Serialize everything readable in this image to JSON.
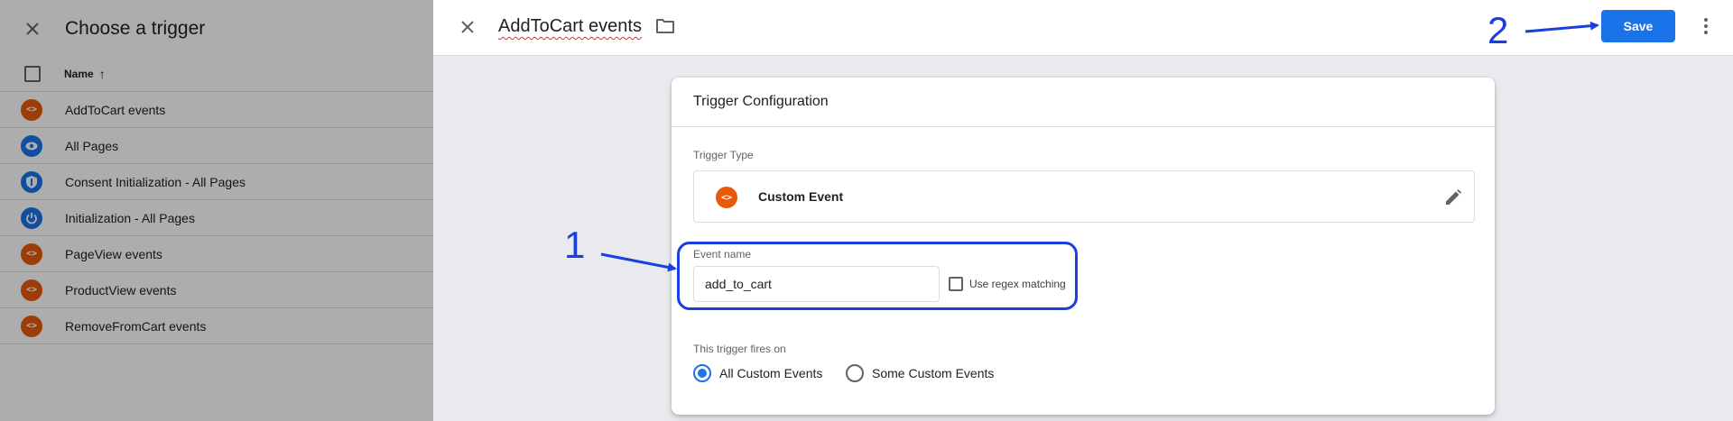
{
  "left_panel": {
    "title": "Choose a trigger",
    "column_header": "Name",
    "sort_arrow": "↑",
    "triggers": [
      {
        "label": "AddToCart events",
        "icon": "code-icon",
        "color": "#e8590c"
      },
      {
        "label": "All Pages",
        "icon": "eye-icon",
        "color": "#1a73e8"
      },
      {
        "label": "Consent Initialization - All Pages",
        "icon": "shield-icon",
        "color": "#1a73e8"
      },
      {
        "label": "Initialization - All Pages",
        "icon": "power-icon",
        "color": "#1a73e8"
      },
      {
        "label": "PageView events",
        "icon": "code-icon",
        "color": "#e8590c"
      },
      {
        "label": "ProductView events",
        "icon": "code-icon",
        "color": "#e8590c"
      },
      {
        "label": "RemoveFromCart events",
        "icon": "code-icon",
        "color": "#e8590c"
      }
    ]
  },
  "header": {
    "title": "AddToCart events",
    "save_label": "Save"
  },
  "card": {
    "title": "Trigger Configuration",
    "trigger_type_label": "Trigger Type",
    "trigger_type_value": "Custom Event",
    "event_name_label": "Event name",
    "event_name_value": "add_to_cart",
    "regex_label": "Use regex matching",
    "fires_on_label": "This trigger fires on",
    "option_all": "All Custom Events",
    "option_some": "Some Custom Events",
    "selected_option": "All Custom Events"
  },
  "annotations": {
    "step1": "1",
    "step2": "2",
    "color": "#1a3fe0"
  },
  "colors": {
    "accent": "#1a73e8",
    "custom_event": "#e8590c"
  }
}
